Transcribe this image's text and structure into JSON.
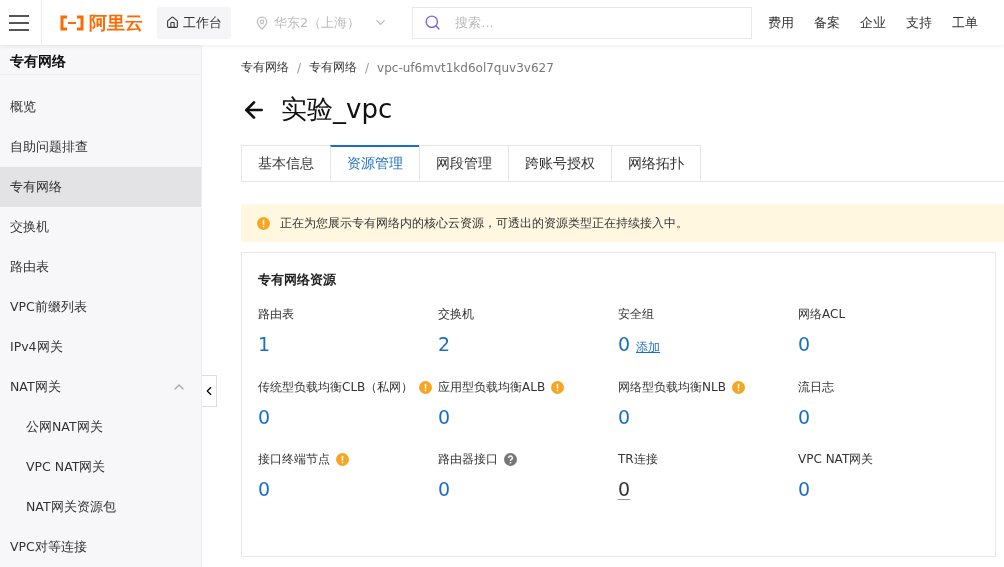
{
  "header": {
    "logo": "阿里云",
    "workbench": "工作台",
    "region": "华东2（上海）",
    "search": {
      "placeholder": "搜索..."
    },
    "nav": [
      "费用",
      "备案",
      "企业",
      "支持",
      "工单"
    ]
  },
  "sidebar": {
    "title": "专有网络",
    "items": [
      {
        "label": "概览",
        "selected": false
      },
      {
        "label": "自助问题排查",
        "selected": false
      },
      {
        "label": "专有网络",
        "selected": true
      },
      {
        "label": "交换机",
        "selected": false
      },
      {
        "label": "路由表",
        "selected": false
      },
      {
        "label": "VPC前缀列表",
        "selected": false
      },
      {
        "label": "IPv4网关",
        "selected": false
      },
      {
        "label": "NAT网关",
        "selected": false,
        "expanded": true,
        "children": [
          {
            "label": "公网NAT网关",
            "selected": false
          },
          {
            "label": "VPC NAT网关",
            "selected": false
          },
          {
            "label": "NAT网关资源包",
            "selected": false
          }
        ]
      },
      {
        "label": "VPC对等连接",
        "selected": false
      }
    ]
  },
  "breadcrumb": {
    "separator": "/",
    "items": [
      "专有网络",
      "专有网络",
      "vpc-uf6mvt1kd6ol7quv3v627"
    ]
  },
  "page_title": "实验_vpc",
  "tabs": [
    {
      "label": "基本信息",
      "selected": false
    },
    {
      "label": "资源管理",
      "selected": true
    },
    {
      "label": "网段管理",
      "selected": false
    },
    {
      "label": "跨账号授权",
      "selected": false
    },
    {
      "label": "网络拓扑",
      "selected": false
    }
  ],
  "notice": "正在为您展示专有网络内的核心云资源，可透出的资源类型正在持续接入中。",
  "resources": {
    "title": "专有网络资源",
    "items": [
      {
        "kind": "plain",
        "label": "路由表",
        "value": "1"
      },
      {
        "kind": "plain",
        "label": "交换机",
        "value": "2"
      },
      {
        "kind": "plain",
        "label": "安全组",
        "value": "0",
        "link": "添加"
      },
      {
        "kind": "plain",
        "label": "网络ACL",
        "value": "0"
      },
      {
        "kind": "warning",
        "label": "传统型负载均衡CLB（私网）",
        "value": "0"
      },
      {
        "kind": "warning",
        "label": "应用型负载均衡ALB",
        "value": "0"
      },
      {
        "kind": "warning",
        "label": "网络型负载均衡NLB",
        "value": "0"
      },
      {
        "kind": "plain",
        "label": "流日志",
        "value": "0"
      },
      {
        "kind": "warning",
        "label": "接口终端节点",
        "value": "0"
      },
      {
        "kind": "help",
        "label": "路由器接口",
        "value": "0"
      },
      {
        "kind": "plain",
        "label": "TR连接",
        "value": "0",
        "underlined": true
      },
      {
        "kind": "plain",
        "label": "VPC NAT网关",
        "value": "0"
      }
    ]
  }
}
